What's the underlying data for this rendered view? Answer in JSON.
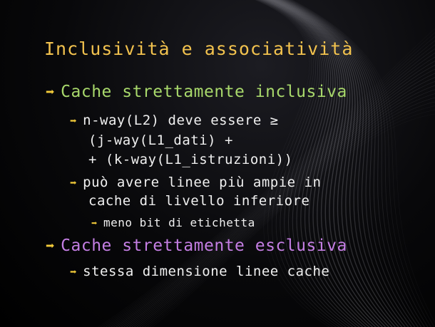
{
  "colors": {
    "title": "#f2c24e",
    "heading1": "#a8d86b",
    "heading2": "#c47ee3",
    "body": "#f0f0f0",
    "arrow": "#f4cc3a"
  },
  "title": "Inclusività e associatività",
  "bullet_icon": "right-arrow-icon",
  "bullet_glyph": "➡",
  "items": [
    {
      "text": "Cache strettamente inclusiva",
      "level": 1,
      "color": "heading1",
      "bullet": true
    },
    {
      "text": "n-way(L2) deve essere ≥",
      "level": 2,
      "color": "body",
      "bullet": true
    },
    {
      "text": "(j-way(L1_dati) +",
      "level": 2,
      "color": "body",
      "bullet": false
    },
    {
      "text": "+ (k-way(L1_istruzioni))",
      "level": 2,
      "color": "body",
      "bullet": false
    },
    {
      "text": "può avere linee più ampie in",
      "level": 2,
      "color": "body",
      "bullet": true
    },
    {
      "text": "cache di livello inferiore",
      "level": 2,
      "color": "body",
      "bullet": false
    },
    {
      "text": "meno bit di etichetta",
      "level": 3,
      "color": "body",
      "bullet": true
    },
    {
      "text": "Cache strettamente esclusiva",
      "level": 1,
      "color": "heading2",
      "bullet": true
    },
    {
      "text": "stessa dimensione linee cache",
      "level": 2,
      "color": "body",
      "bullet": true
    }
  ]
}
